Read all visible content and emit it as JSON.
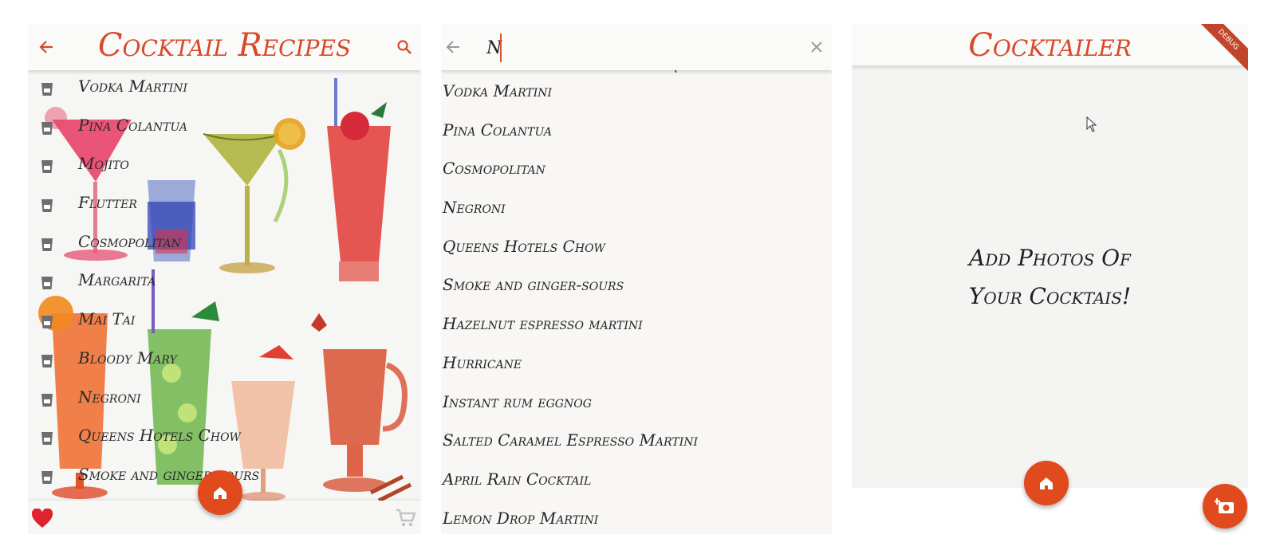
{
  "left_screen": {
    "title": "Cocktail Recipes",
    "cocktails": [
      "Vodka Martini",
      "Pina Colantua",
      "Mojito",
      "Flutter",
      "Cosmopolitan",
      "Margarita",
      "Mai Tai",
      "Bloody Mary",
      "Negroni",
      "Queens Hotels Chow",
      "Smoke and ginger-sours"
    ],
    "icons": {
      "back": "arrow-left-icon",
      "search": "search-icon",
      "favorite": "heart-icon",
      "cart": "cart-icon",
      "home": "home-icon"
    }
  },
  "search_screen": {
    "query": "N",
    "results": [
      "Vodka Martini",
      "Pina Colantua",
      "Cosmopolitan",
      "Negroni",
      "Queens Hotels Chow",
      "Smoke and ginger-sours",
      "Hazelnut espresso martini",
      "Hurricane",
      "Instant rum eggnog",
      "Salted Caramel Espresso Martini",
      "April Rain Cocktail",
      "Lemon Drop Martini"
    ],
    "icons": {
      "back": "arrow-left-icon",
      "clear": "close-icon"
    }
  },
  "right_screen": {
    "title": "Cocktailer",
    "empty_message_line1": "Add Photos Of",
    "empty_message_line2": "Your Cocktais!",
    "debug_banner": "DEBUG",
    "icons": {
      "home": "home-icon",
      "camera": "add-photo-icon"
    }
  },
  "colors": {
    "accent": "#d8482a",
    "fab": "#e04a1c",
    "text": "#2b2b2b"
  }
}
